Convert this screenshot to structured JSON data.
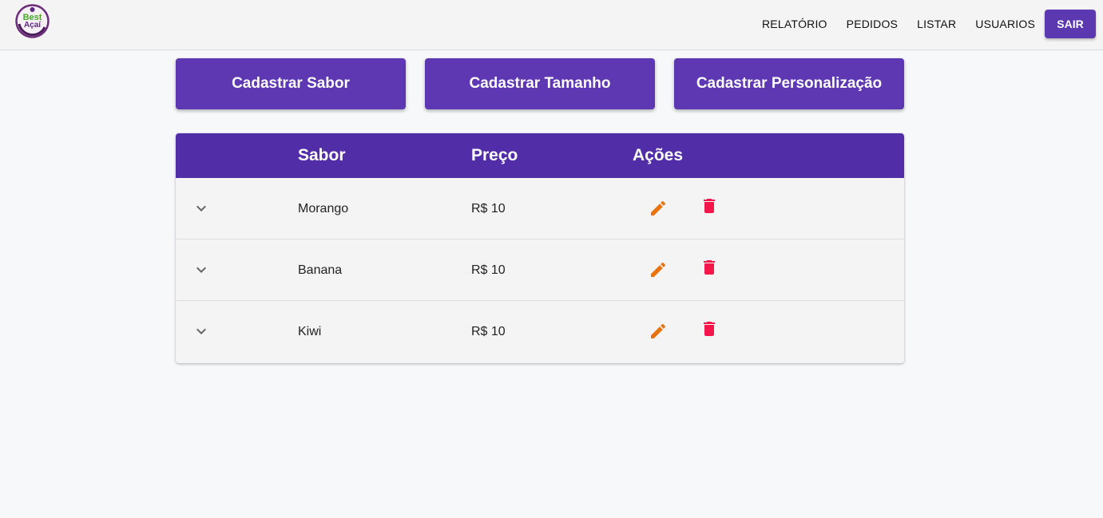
{
  "header": {
    "logo": {
      "line1": "Best",
      "line2": "Açaí"
    },
    "nav": [
      {
        "label": "RELATÓRIO"
      },
      {
        "label": "PEDIDOS"
      },
      {
        "label": "LISTAR"
      },
      {
        "label": "USUARIOS"
      }
    ],
    "logout_label": "SAIR"
  },
  "actions": [
    {
      "label": "Cadastrar Sabor"
    },
    {
      "label": "Cadastrar Tamanho"
    },
    {
      "label": "Cadastrar Personalização"
    }
  ],
  "table": {
    "columns": [
      "Sabor",
      "Preço",
      "Ações"
    ],
    "rows": [
      {
        "sabor": "Morango",
        "preco": "R$ 10"
      },
      {
        "sabor": "Banana",
        "preco": "R$ 10"
      },
      {
        "sabor": "Kiwi",
        "preco": "R$ 10"
      }
    ]
  },
  "icons": {
    "expand": "chevron-down-icon",
    "edit": "pencil-icon",
    "delete": "trash-icon"
  },
  "colors": {
    "primary": "#512da8",
    "button": "#5e37b2",
    "edit_icon": "#e8730c",
    "delete_icon": "#f5164a"
  }
}
